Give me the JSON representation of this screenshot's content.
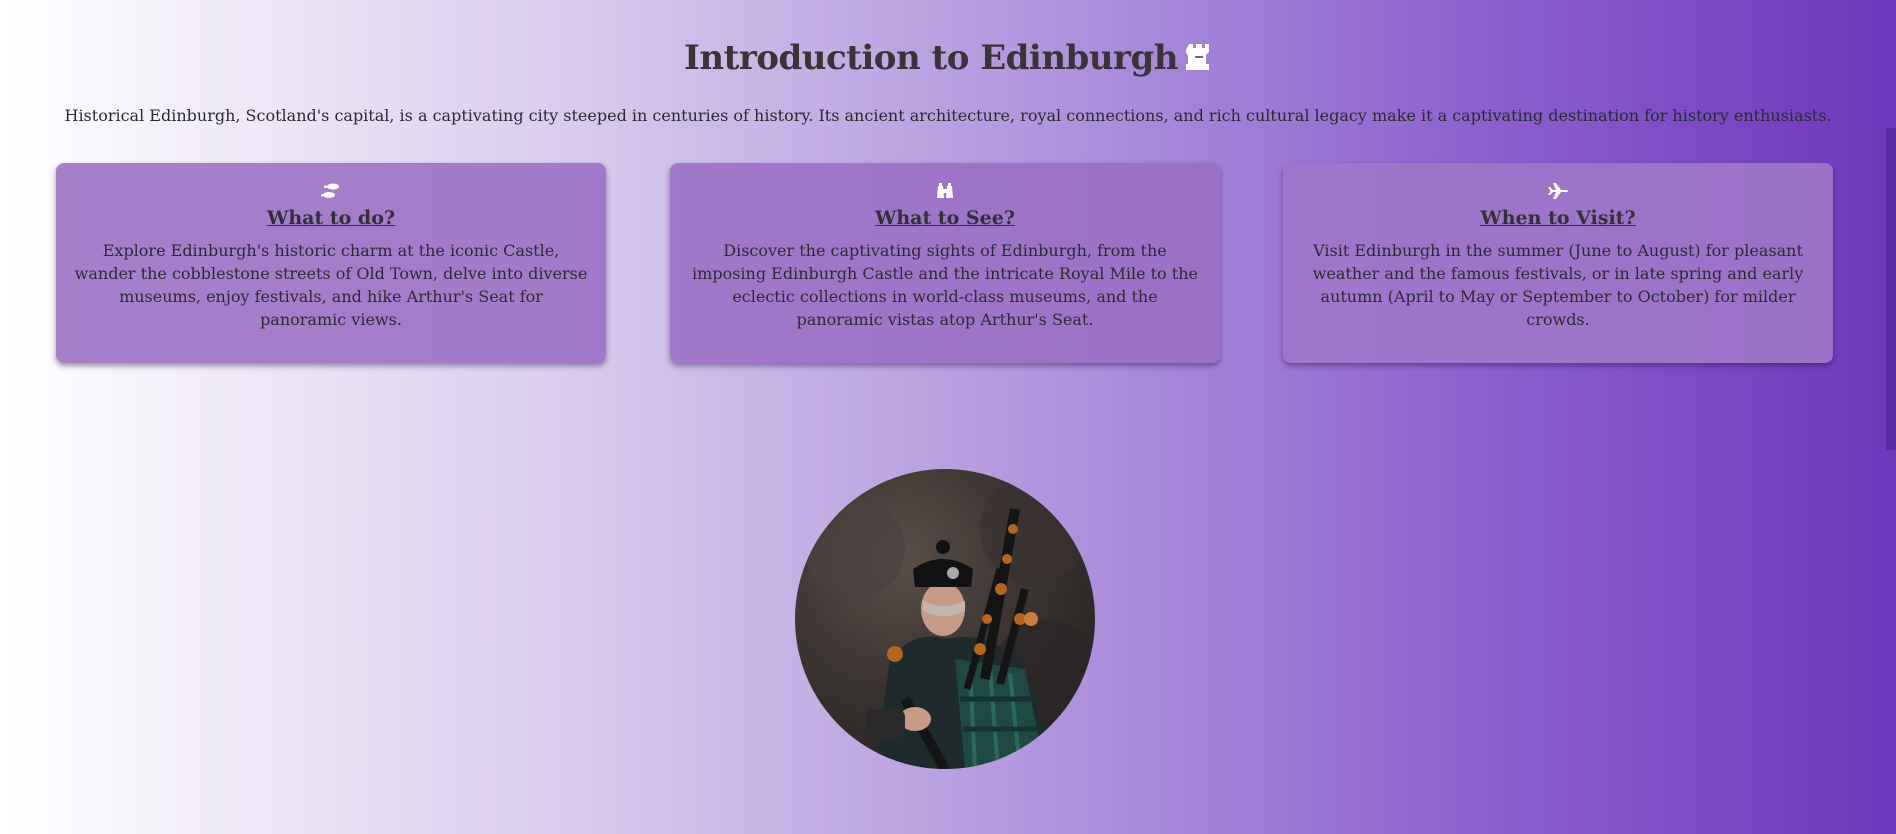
{
  "header": {
    "title": "Introduction to Edinburgh",
    "title_icon": "castle-rook-icon",
    "intro": "Historical Edinburgh, Scotland's capital, is a captivating city steeped in centuries of history. Its ancient architecture, royal connections, and rich cultural legacy make it a captivating destination for history enthusiasts."
  },
  "cards": [
    {
      "icon": "footprints-icon",
      "title": "What to do?",
      "text": "Explore Edinburgh's historic charm at the iconic Castle, wander the cobblestone streets of Old Town, delve into diverse museums, enjoy festivals, and hike Arthur's Seat for panoramic views."
    },
    {
      "icon": "binoculars-icon",
      "title": "What to See?",
      "text": "Discover the captivating sights of Edinburgh, from the imposing Edinburgh Castle and the intricate Royal Mile to the eclectic collections in world-class museums, and the panoramic vistas atop Arthur's Seat."
    },
    {
      "icon": "plane-icon",
      "title": "When to Visit?",
      "text": "Visit Edinburgh in the summer (June to August) for pleasant weather and the famous festivals, or in late spring and early autumn (April to May or September to October) for milder crowds."
    }
  ],
  "image": {
    "subject": "bagpiper-photo"
  },
  "colors": {
    "gradient_start": "#ffffff",
    "gradient_end": "#6f38bd",
    "card_bg": "#9b6ec3",
    "text": "#2f2f33"
  }
}
